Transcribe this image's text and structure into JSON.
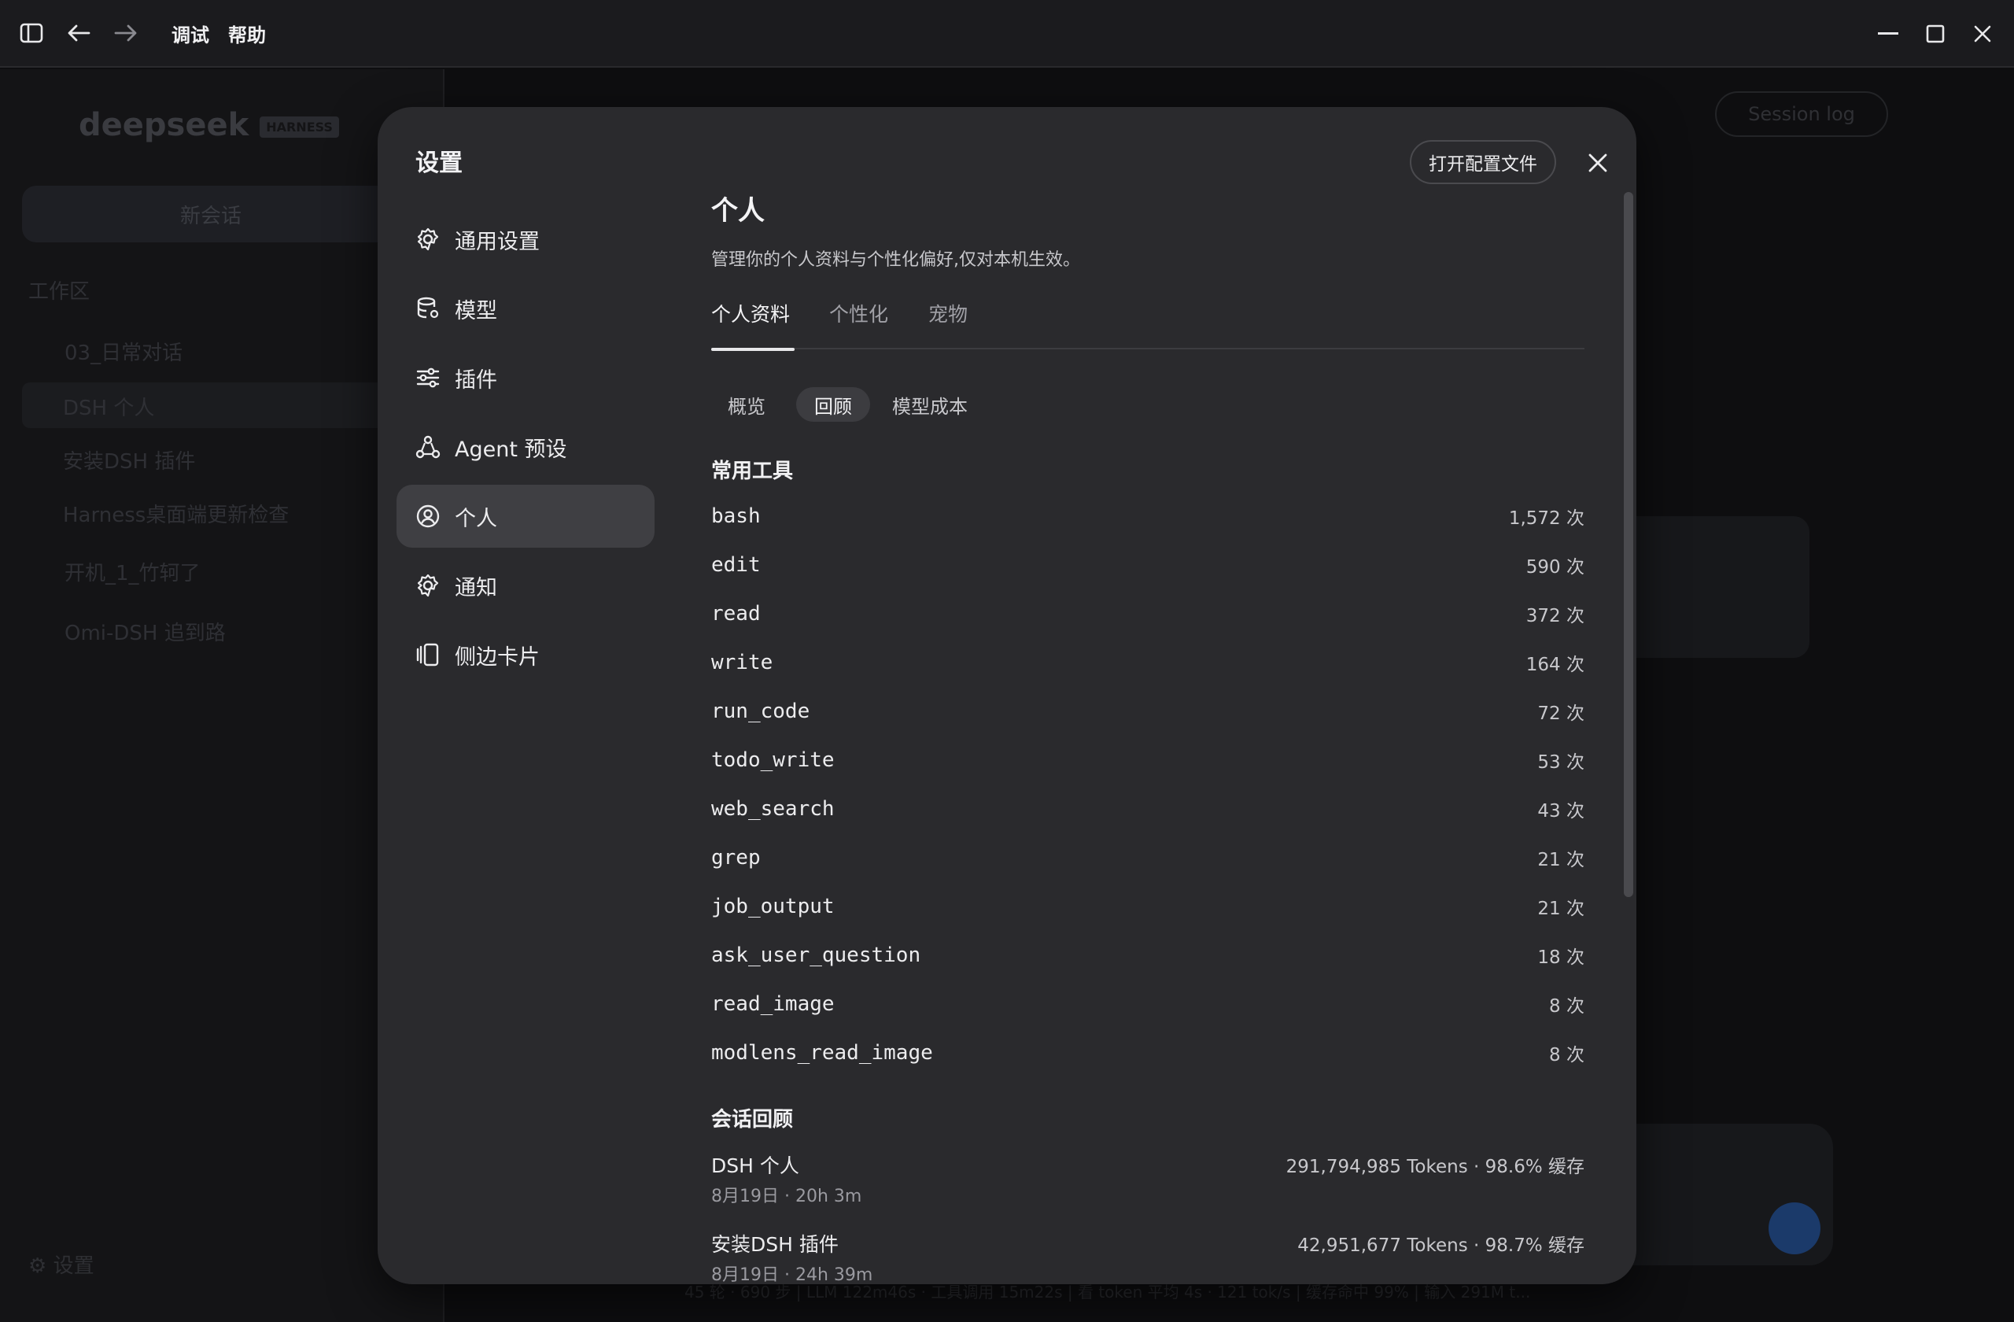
{
  "titlebar": {
    "menus": [
      "调试",
      "帮助"
    ]
  },
  "background": {
    "logo": "deepseek",
    "logo_tag": "HARNESS",
    "new_chat": "新会话",
    "workspace_label": "工作区",
    "folders": [
      "03_日常对话",
      "开机_1_竹轲了",
      "Omi-DSH 追到路"
    ],
    "sessions": [
      "DSH 个人",
      "安装DSH 插件",
      "Harness桌面端更新检查"
    ],
    "session_log": "Session log",
    "settings": "设置",
    "status_line": "45 轮 · 690 步 | LLM 122m46s · 工具调用 15m22s | 看 token 平均 4s · 121 tok/s | 缓存命中 99% | 输入 291M t..."
  },
  "modal": {
    "title": "设置",
    "nav": [
      {
        "label": "通用设置",
        "icon": "gear-icon"
      },
      {
        "label": "模型",
        "icon": "database-icon"
      },
      {
        "label": "插件",
        "icon": "sliders-icon"
      },
      {
        "label": "Agent 预设",
        "icon": "agent-icon"
      },
      {
        "label": "个人",
        "icon": "user-circle-icon"
      },
      {
        "label": "通知",
        "icon": "gear-icon"
      },
      {
        "label": "侧边卡片",
        "icon": "cards-icon"
      }
    ],
    "active_nav": "个人",
    "open_config": "打开配置文件",
    "section_title": "个人",
    "section_desc": "管理你的个人资料与个性化偏好,仅对本机生效。",
    "tabs": [
      "个人资料",
      "个性化",
      "宠物"
    ],
    "active_tab": "个人资料",
    "segments": [
      "概览",
      "回顾",
      "模型成本"
    ],
    "active_segment": "回顾",
    "tools_title": "常用工具",
    "tools": [
      {
        "name": "bash",
        "count": "1,572 次"
      },
      {
        "name": "edit",
        "count": "590 次"
      },
      {
        "name": "read",
        "count": "372 次"
      },
      {
        "name": "write",
        "count": "164 次"
      },
      {
        "name": "run_code",
        "count": "72 次"
      },
      {
        "name": "todo_write",
        "count": "53 次"
      },
      {
        "name": "web_search",
        "count": "43 次"
      },
      {
        "name": "grep",
        "count": "21 次"
      },
      {
        "name": "job_output",
        "count": "21 次"
      },
      {
        "name": "ask_user_question",
        "count": "18 次"
      },
      {
        "name": "read_image",
        "count": "8 次"
      },
      {
        "name": "modlens_read_image",
        "count": "8 次"
      }
    ],
    "sessions_title": "会话回顾",
    "sessions": [
      {
        "name": "DSH 个人",
        "stat": "291,794,985 Tokens · 98.6% 缓存",
        "meta": "8月19日 · 20h 3m"
      },
      {
        "name": "安装DSH 插件",
        "stat": "42,951,677 Tokens · 98.7% 缓存",
        "meta": "8月19日 · 24h 39m"
      }
    ]
  },
  "colors": {
    "modal_bg": "#2a2a2d",
    "active_nav_bg": "#3f3f43",
    "text_primary": "#ececee",
    "text_secondary": "#c8c8cc"
  }
}
